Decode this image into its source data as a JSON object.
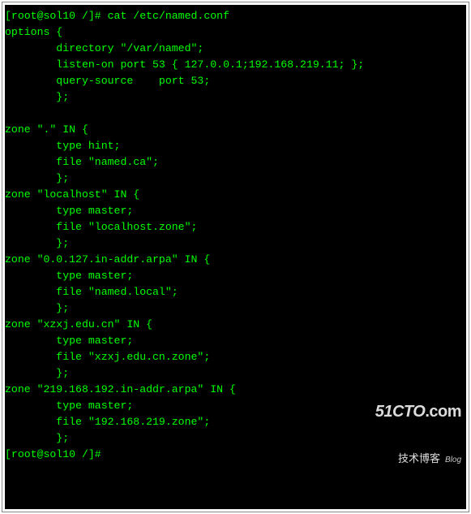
{
  "terminal": {
    "prompt1_user_host": "[root@sol10 /]#",
    "prompt1_cmd": " cat /etc/named.conf",
    "lines": [
      "options {",
      "        directory \"/var/named\";",
      "        listen-on port 53 { 127.0.0.1;192.168.219.11; };",
      "        query-source    port 53;",
      "        };",
      "",
      "zone \".\" IN {",
      "        type hint;",
      "        file \"named.ca\";",
      "        };",
      "zone \"localhost\" IN {",
      "        type master;",
      "        file \"localhost.zone\";",
      "        };",
      "zone \"0.0.127.in-addr.arpa\" IN {",
      "        type master;",
      "        file \"named.local\";",
      "        };",
      "zone \"xzxj.edu.cn\" IN {",
      "        type master;",
      "        file \"xzxj.edu.cn.zone\";",
      "        };",
      "zone \"219.168.192.in-addr.arpa\" IN {",
      "        type master;",
      "        file \"192.168.219.zone\";",
      "        };"
    ],
    "prompt2_user_host": "[root@sol10 /]#",
    "prompt2_cmd": " "
  },
  "watermark": {
    "top": "51CTO",
    "top_suffix": ".com",
    "bottom_cn": "技术博客",
    "bottom_en": "Blog"
  }
}
